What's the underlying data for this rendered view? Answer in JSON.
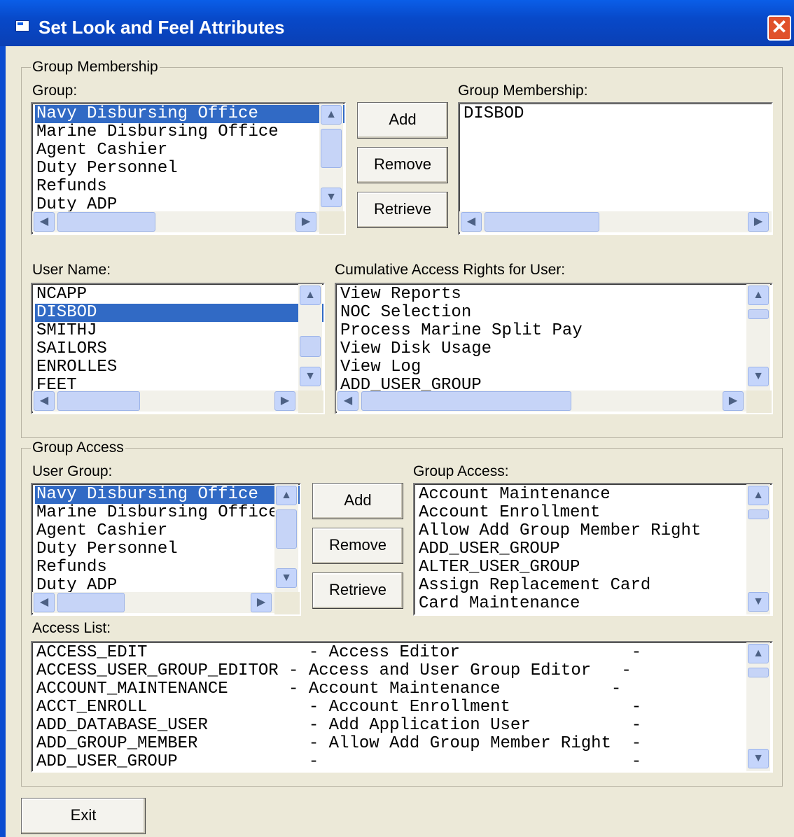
{
  "window": {
    "title": "Set Look and Feel Attributes",
    "close_label": "✕"
  },
  "group_membership_section": {
    "title": "Group Membership",
    "group_label": "Group:",
    "groups": [
      {
        "text": "Navy Disbursing Office",
        "selected": true
      },
      {
        "text": "Marine Disbursing Office",
        "selected": false
      },
      {
        "text": "Agent Cashier",
        "selected": false
      },
      {
        "text": "Duty Personnel",
        "selected": false
      },
      {
        "text": "Refunds",
        "selected": false
      },
      {
        "text": "Duty ADP",
        "selected": false
      }
    ],
    "buttons": {
      "add": "Add",
      "remove": "Remove",
      "retrieve": "Retrieve"
    },
    "membership_label": "Group Membership:",
    "membership": [
      {
        "text": "DISBOD",
        "selected": false
      }
    ],
    "user_name_label": "User Name:",
    "users": [
      {
        "text": "NCAPP",
        "selected": false
      },
      {
        "text": "DISBOD",
        "selected": true
      },
      {
        "text": "SMITHJ",
        "selected": false
      },
      {
        "text": "SAILORS",
        "selected": false
      },
      {
        "text": "ENROLLES",
        "selected": false
      },
      {
        "text": "FEET",
        "selected": false
      }
    ],
    "rights_label": "Cumulative Access Rights for User:",
    "rights": [
      {
        "text": "View Reports",
        "selected": false
      },
      {
        "text": "NOC Selection",
        "selected": false
      },
      {
        "text": "Process Marine Split Pay",
        "selected": false
      },
      {
        "text": "View Disk Usage",
        "selected": false
      },
      {
        "text": "View Log",
        "selected": false
      },
      {
        "text": "ADD_USER_GROUP",
        "selected": false
      }
    ]
  },
  "group_access_section": {
    "title": "Group Access",
    "user_group_label": "User Group:",
    "user_groups": [
      {
        "text": "Navy Disbursing Office",
        "selected": true
      },
      {
        "text": "Marine Disbursing Office",
        "selected": false
      },
      {
        "text": "Agent Cashier",
        "selected": false
      },
      {
        "text": "Duty Personnel",
        "selected": false
      },
      {
        "text": "Refunds",
        "selected": false
      },
      {
        "text": "Duty ADP",
        "selected": false
      }
    ],
    "buttons": {
      "add": "Add",
      "remove": "Remove",
      "retrieve": "Retrieve"
    },
    "group_access_label": "Group Access:",
    "group_access": [
      {
        "text": "Account Maintenance",
        "selected": false
      },
      {
        "text": "Account Enrollment",
        "selected": false
      },
      {
        "text": "Allow Add Group Member Right",
        "selected": false
      },
      {
        "text": "ADD_USER_GROUP",
        "selected": false
      },
      {
        "text": "ALTER_USER_GROUP",
        "selected": false
      },
      {
        "text": "Assign Replacement Card",
        "selected": false
      },
      {
        "text": "Card Maintenance",
        "selected": false
      }
    ],
    "access_list_label": "Access List:",
    "access_list": [
      {
        "text": "ACCESS_EDIT                - Access Editor                 -",
        "selected": false
      },
      {
        "text": "ACCESS_USER_GROUP_EDITOR - Access and User Group Editor   -",
        "selected": false
      },
      {
        "text": "ACCOUNT_MAINTENANCE      - Account Maintenance           -",
        "selected": false
      },
      {
        "text": "ACCT_ENROLL                - Account Enrollment            -",
        "selected": false
      },
      {
        "text": "ADD_DATABASE_USER          - Add Application User          -",
        "selected": false
      },
      {
        "text": "ADD_GROUP_MEMBER           - Allow Add Group Member Right  -",
        "selected": false
      },
      {
        "text": "ADD_USER_GROUP             -                               -",
        "selected": false
      }
    ]
  },
  "exit_label": "Exit"
}
